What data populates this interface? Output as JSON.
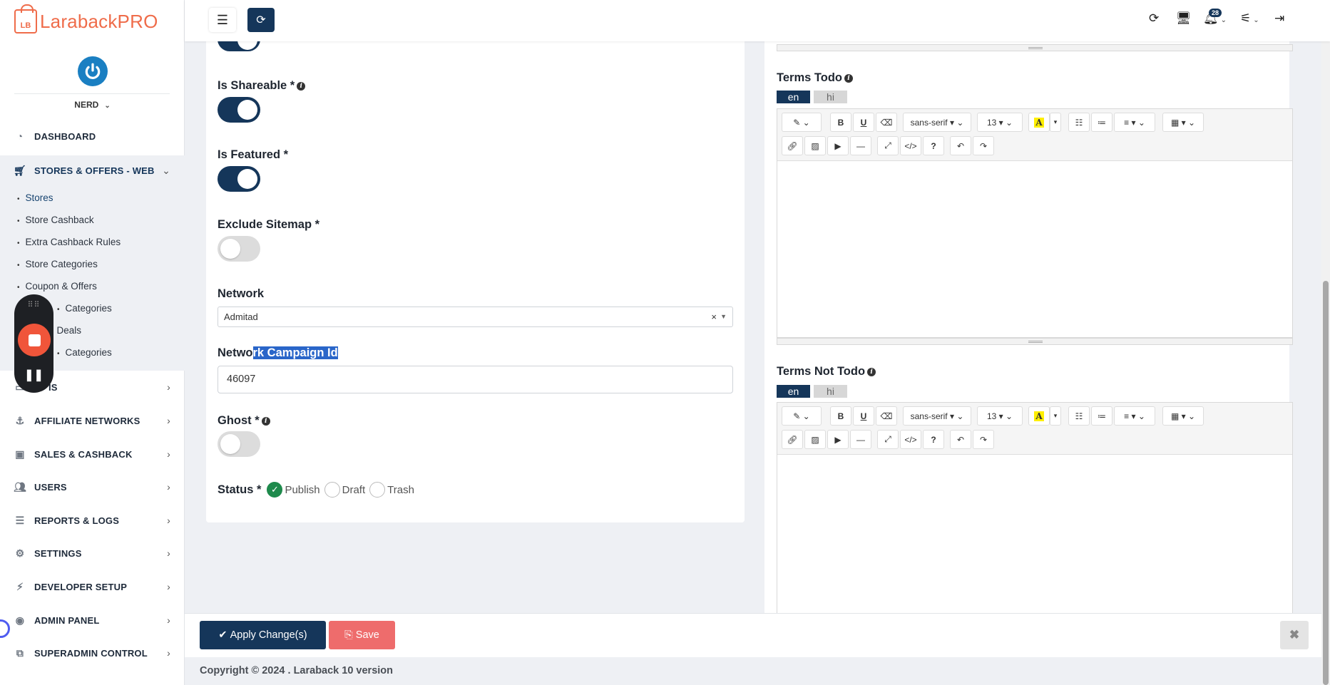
{
  "brand": {
    "box": "LB",
    "name": "LarabackPRO"
  },
  "user": {
    "name": "NERD"
  },
  "sidebar": {
    "items": [
      {
        "label": "DASHBOARD",
        "icon": "dashboard-icon"
      },
      {
        "label": "STORES & OFFERS - WEB",
        "icon": "cart-icon"
      },
      {
        "label": "IS",
        "icon": "card-icon"
      },
      {
        "label": "AFFILIATE NETWORKS",
        "icon": "anchor-icon"
      },
      {
        "label": "SALES & CASHBACK",
        "icon": "money-icon"
      },
      {
        "label": "USERS",
        "icon": "users-icon"
      },
      {
        "label": "REPORTS & LOGS",
        "icon": "list-icon"
      },
      {
        "label": "SETTINGS",
        "icon": "gears-icon"
      },
      {
        "label": "DEVELOPER SETUP",
        "icon": "plug-icon"
      },
      {
        "label": "ADMIN PANEL",
        "icon": "admin-icon"
      },
      {
        "label": "SUPERADMIN CONTROL",
        "icon": "sitemap-icon"
      }
    ],
    "sub_items": [
      "Stores",
      "Store Cashback",
      "Extra Cashback Rules",
      "Store Categories",
      "Coupon & Offers",
      "Categories",
      "Deals",
      "Categories"
    ]
  },
  "topbar": {
    "notification_count": "28"
  },
  "form": {
    "is_shareable": {
      "label": "Is Shareable *",
      "on": true
    },
    "is_featured": {
      "label": "Is Featured *",
      "on": true
    },
    "exclude_sitemap": {
      "label": "Exclude Sitemap *",
      "on": false
    },
    "network": {
      "label": "Network",
      "value": "Admitad",
      "clear": "×"
    },
    "campaign": {
      "label_start": "Netwo",
      "label_selected": "rk Campaign Id",
      "value": "46097"
    },
    "ghost": {
      "label": "Ghost *",
      "on": false
    },
    "status": {
      "label": "Status *",
      "options": [
        "Publish",
        "Draft",
        "Trash"
      ],
      "selected": "Publish"
    }
  },
  "editors": {
    "terms_todo": {
      "title": "Terms Todo",
      "tabs": [
        "en",
        "hi"
      ]
    },
    "terms_not_todo": {
      "title": "Terms Not Todo",
      "tabs": [
        "en",
        "hi"
      ]
    },
    "toolbar": {
      "font": "sans-serif",
      "size": "13",
      "color_letter": "A",
      "help": "?",
      "code": "</>"
    }
  },
  "actions": {
    "apply": "Apply Change(s)",
    "save": "Save",
    "close": "✖"
  },
  "footer": {
    "copyright": "Copyright © 2024 .",
    "product": "Laraback 10 version"
  },
  "colors": {
    "primary": "#15365a",
    "accent": "#ef6c4a",
    "save": "#ee6c6c",
    "success": "#1e8a4c"
  }
}
